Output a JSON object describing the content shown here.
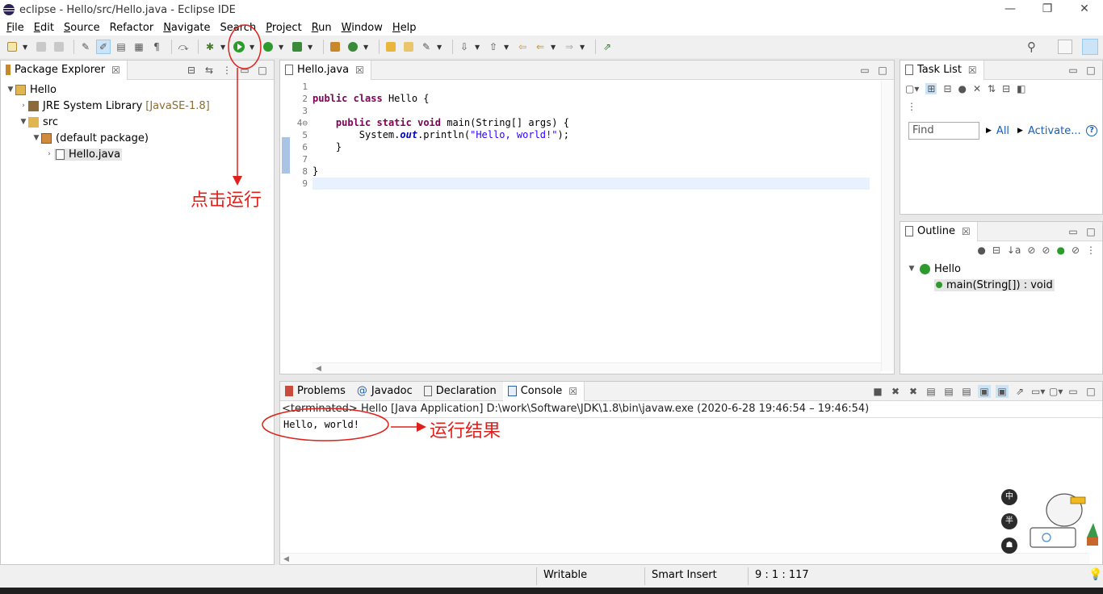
{
  "window": {
    "title": "eclipse - Hello/src/Hello.java - Eclipse IDE",
    "min": "—",
    "restore": "❐",
    "close": "✕"
  },
  "menu": [
    "File",
    "Edit",
    "Source",
    "Refactor",
    "Navigate",
    "Search",
    "Project",
    "Run",
    "Window",
    "Help"
  ],
  "package_explorer": {
    "tab_label": "Package Explorer",
    "tree": {
      "project": "Hello",
      "jre": "JRE System Library",
      "jre_version": "[JavaSE-1.8]",
      "src": "src",
      "package": "(default package)",
      "file": "Hello.java"
    }
  },
  "editor": {
    "tab_label": "Hello.java",
    "line_numbers": [
      "1",
      "2",
      "3",
      "4⊖",
      "5",
      "6",
      "7",
      "8",
      "9"
    ],
    "code": {
      "l2_kw1": "public",
      "l2_kw2": "class",
      "l2_rest": " Hello {",
      "l4_kw1": "public",
      "l4_kw2": "static",
      "l4_kw3": "void",
      "l4_rest": " main(String[] args) {",
      "l5_a": "System.",
      "l5_field": "out",
      "l5_b": ".println(",
      "l5_str": "\"Hello, world!\"",
      "l5_c": ");",
      "l6": "}",
      "l8": "}"
    }
  },
  "task_list": {
    "tab_label": "Task List",
    "find_placeholder": "Find",
    "all_label": "All",
    "activate_label": "Activate..."
  },
  "outline": {
    "tab_label": "Outline",
    "class_name": "Hello",
    "method_sig": "main(String[]) : void"
  },
  "console_area": {
    "tabs": [
      "Problems",
      "Javadoc",
      "Declaration",
      "Console"
    ],
    "description": "<terminated> Hello [Java Application] D:\\work\\Software\\JDK\\1.8\\bin\\javaw.exe  (2020-6-28 19:46:54 – 19:46:54)",
    "output": "Hello, world!"
  },
  "status": {
    "writable": "Writable",
    "insert_mode": "Smart Insert",
    "position": "9 : 1 : 117"
  },
  "annotations": {
    "run_hint": "点击运行",
    "result_hint": "运行结果"
  },
  "ime": [
    "中",
    "半",
    "☗"
  ],
  "colors": {
    "annotation_red": "#e0201b",
    "keyword": "#7f0055",
    "string": "#2a00ff",
    "run_green": "#2c9b2c"
  }
}
